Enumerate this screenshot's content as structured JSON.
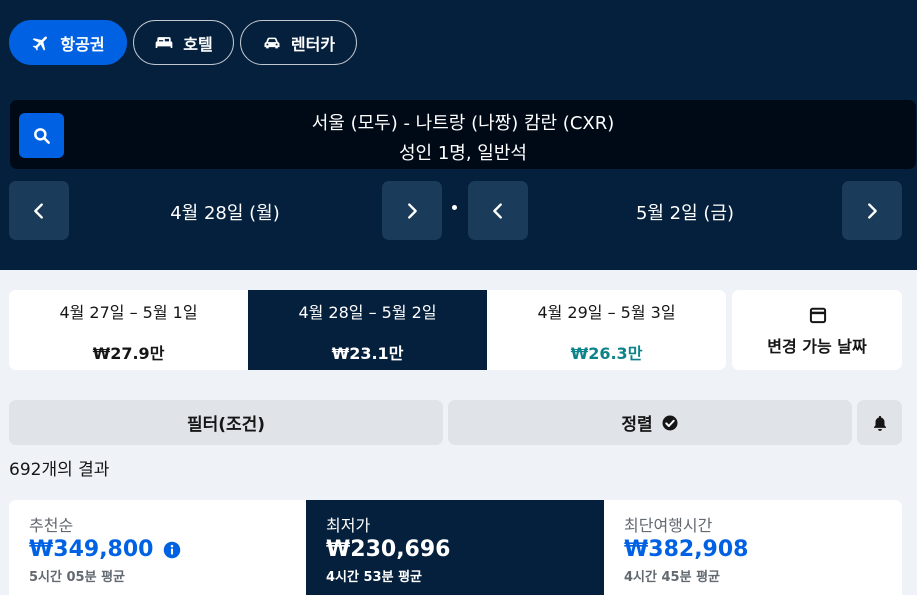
{
  "tabs": [
    {
      "label": "항공권",
      "icon": "airplane-icon",
      "active": true
    },
    {
      "label": "호텔",
      "icon": "bed-icon",
      "active": false
    },
    {
      "label": "렌터카",
      "icon": "car-icon",
      "active": false
    }
  ],
  "search": {
    "route": "서울 (모두) - 나트랑 (나짱) 캄란 (CXR)",
    "travellers": "성인 1명, 일반석"
  },
  "dates": {
    "depart": "4월 28일 (월)",
    "return": "5월 2일 (금)"
  },
  "date_options": [
    {
      "range": "4월 27일 – 5월 1일",
      "price": "₩27.9만"
    },
    {
      "range": "4월 28일 – 5월 2일",
      "price": "₩23.1만"
    },
    {
      "range": "4월 29일 – 5월 3일",
      "price": "₩26.3만"
    }
  ],
  "flexible": {
    "label": "변경 가능 날짜",
    "icon": "calendar-icon"
  },
  "tools": {
    "filter": "필터(조건)",
    "sort": "정렬",
    "alert_icon": "bell-icon"
  },
  "results_count": "692개의 결과",
  "sort_options": [
    {
      "title": "추천순",
      "price": "₩349,800",
      "avg": "5시간 05분 평균"
    },
    {
      "title": "최저가",
      "price": "₩230,696",
      "avg": "4시간 53분 평균"
    },
    {
      "title": "최단여행시간",
      "price": "₩382,908",
      "avg": "4시간 45분 평균"
    }
  ],
  "colors": {
    "header_bg": "#05203c",
    "accent": "#0062e3",
    "green_price": "#0c838a",
    "page_bg": "#eff3f8"
  }
}
